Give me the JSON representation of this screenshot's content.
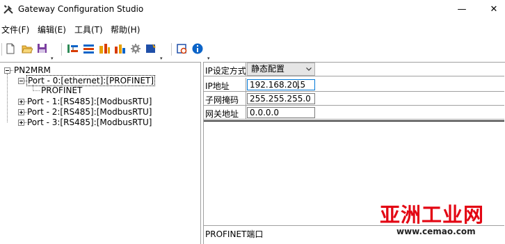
{
  "window": {
    "title": "Gateway Configuration Studio",
    "icon": "tools-icon",
    "minimize_glyph": "—",
    "close_glyph": "✕"
  },
  "menu": {
    "items": [
      {
        "label": "文件(F)"
      },
      {
        "label": "编辑(E)"
      },
      {
        "label": "工具(T)"
      },
      {
        "label": "帮助(H)"
      }
    ]
  },
  "toolbar": {
    "buttons": [
      "new-file-icon",
      "open-folder-icon",
      "save-icon",
      "add-port-icon",
      "remove-port-icon",
      "upload-icon",
      "download-icon",
      "settings-gear-icon",
      "config-icon",
      "monitor-icon",
      "info-icon"
    ],
    "colors": {
      "accent": "#0c64c8",
      "red": "#d83b01",
      "orange": "#e8a000",
      "green": "#2e8b57"
    }
  },
  "tree": {
    "root": "PN2MRM",
    "ports": [
      {
        "label": "Port - 0:[ethernet]:[PROFINET]",
        "expanded": true,
        "selected": true,
        "children": [
          "PROFINET"
        ]
      },
      {
        "label": "Port - 1:[RS485]:[ModbusRTU]",
        "expanded": false
      },
      {
        "label": "Port - 2:[RS485]:[ModbusRTU]",
        "expanded": false
      },
      {
        "label": "Port - 3:[RS485]:[ModbusRTU]",
        "expanded": false
      }
    ]
  },
  "properties": {
    "rows": [
      {
        "label": "IP设定方式",
        "value": "静态配置",
        "kind": "select"
      },
      {
        "label": "IP地址",
        "value_before_caret": "192.168.20",
        "value_after_caret": ".5",
        "kind": "input"
      },
      {
        "label": "子网掩码",
        "value": "255.255.255.0",
        "kind": "input"
      },
      {
        "label": "网关地址",
        "value": "0.0.0.0",
        "kind": "input"
      }
    ]
  },
  "description": "PROFINET端口",
  "watermark": {
    "brand_cn": "亚洲工业网",
    "url": "www.cemao.com"
  }
}
